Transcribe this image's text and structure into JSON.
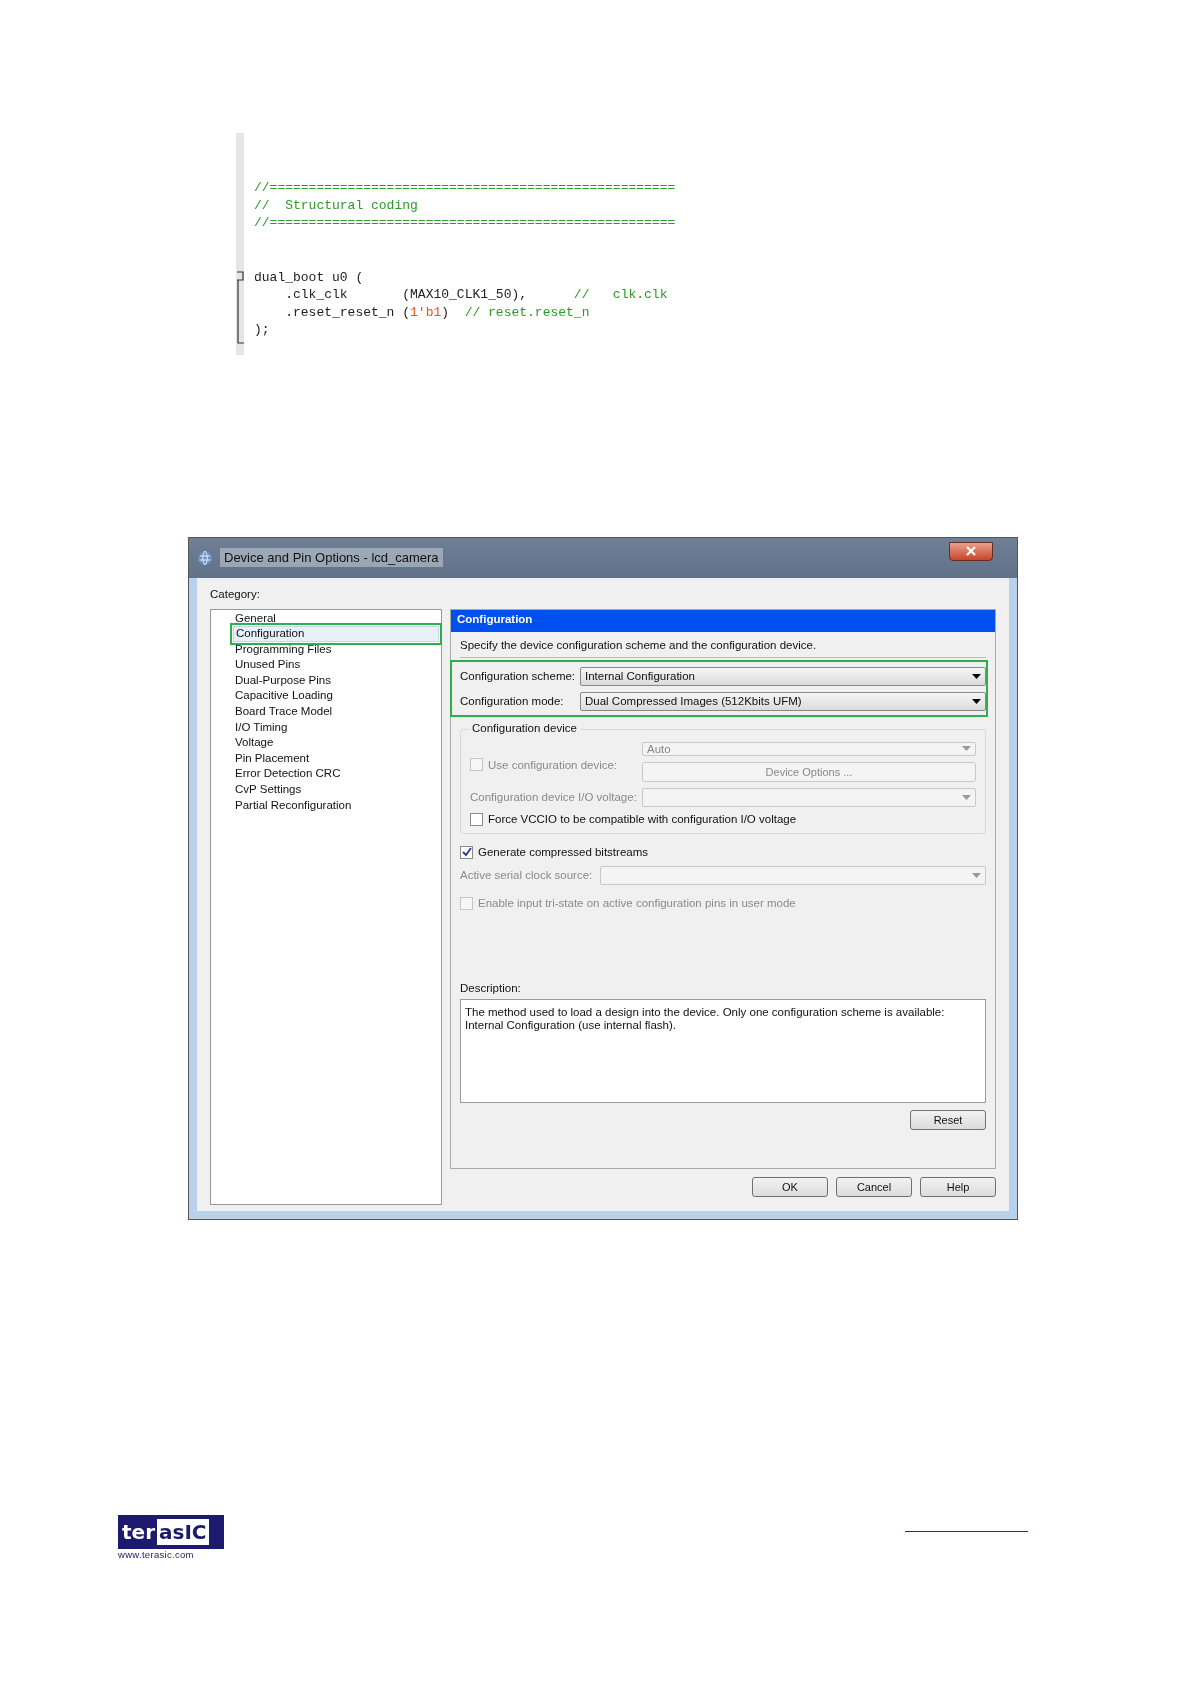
{
  "code_listing": {
    "blocks": [
      [
        [
          {
            "kind": "comment",
            "text": "//===================================================="
          }
        ],
        [
          {
            "kind": "comment",
            "text": "//  Structural coding"
          }
        ],
        [
          {
            "kind": "comment",
            "text": "//===================================================="
          }
        ]
      ],
      [
        [
          {
            "kind": "plain",
            "text": "dual_boot u0 ("
          }
        ],
        [
          {
            "kind": "plain",
            "text": "    .clk_clk       (MAX10_CLK1_50),      "
          },
          {
            "kind": "comment",
            "text": "//   clk.clk"
          }
        ],
        [
          {
            "kind": "plain",
            "text": "    .reset_reset_n ("
          },
          {
            "kind": "number",
            "text": "1'b1"
          },
          {
            "kind": "plain",
            "text": ")  "
          },
          {
            "kind": "comment",
            "text": "// reset.reset_n"
          }
        ],
        [
          {
            "kind": "plain",
            "text": ");"
          }
        ]
      ]
    ]
  },
  "window": {
    "title": "Device and Pin Options - lcd_camera"
  },
  "category_label": "Category:",
  "categories": [
    {
      "label": "General",
      "selected": false,
      "highlighted": false
    },
    {
      "label": "Configuration",
      "selected": true,
      "highlighted": true
    },
    {
      "label": "Programming Files",
      "selected": false,
      "highlighted": false
    },
    {
      "label": "Unused Pins",
      "selected": false,
      "highlighted": false
    },
    {
      "label": "Dual-Purpose Pins",
      "selected": false,
      "highlighted": false
    },
    {
      "label": "Capacitive Loading",
      "selected": false,
      "highlighted": false
    },
    {
      "label": "Board Trace Model",
      "selected": false,
      "highlighted": false
    },
    {
      "label": "I/O Timing",
      "selected": false,
      "highlighted": false
    },
    {
      "label": "Voltage",
      "selected": false,
      "highlighted": false
    },
    {
      "label": "Pin Placement",
      "selected": false,
      "highlighted": false
    },
    {
      "label": "Error Detection CRC",
      "selected": false,
      "highlighted": false
    },
    {
      "label": "CvP Settings",
      "selected": false,
      "highlighted": false
    },
    {
      "label": "Partial Reconfiguration",
      "selected": false,
      "highlighted": false
    }
  ],
  "panel": {
    "header": "Configuration",
    "intro": "Specify the device configuration scheme and the configuration device.",
    "fields_highlighted": true,
    "fields": [
      {
        "label": "Configuration scheme:",
        "value": "Internal Configuration"
      },
      {
        "label": "Configuration mode:",
        "value": "Dual Compressed Images (512Kbits UFM)"
      }
    ],
    "config_device": {
      "legend": "Configuration device",
      "use_device": {
        "label": "Use configuration device:",
        "checked": false,
        "disabled": true
      },
      "device_select": {
        "value": "Auto",
        "disabled": true
      },
      "options_button": {
        "label": "Device Options ...",
        "disabled": true
      },
      "io_voltage": {
        "label": "Configuration device I/O voltage:",
        "disabled": true
      },
      "force_vccio": {
        "label": "Force VCCIO to be compatible with configuration I/O voltage",
        "checked": false,
        "disabled": false
      }
    },
    "generate_compressed": {
      "label": "Generate compressed bitstreams",
      "checked": true,
      "disabled": false
    },
    "serial_clock": {
      "label": "Active serial clock source:",
      "disabled": true
    },
    "tristate": {
      "label": "Enable input tri-state on active configuration pins in user mode",
      "checked": false,
      "disabled": true
    },
    "description_label": "Description:",
    "description_text": "The method used to load a design into the device. Only one configuration scheme is available: Internal Configuration (use internal flash).",
    "reset_button": "Reset"
  },
  "buttons": [
    "OK",
    "Cancel",
    "Help"
  ],
  "footer": {
    "logo_left": "ter",
    "logo_right": "asIC",
    "logo_url": "www.terasic.com"
  }
}
